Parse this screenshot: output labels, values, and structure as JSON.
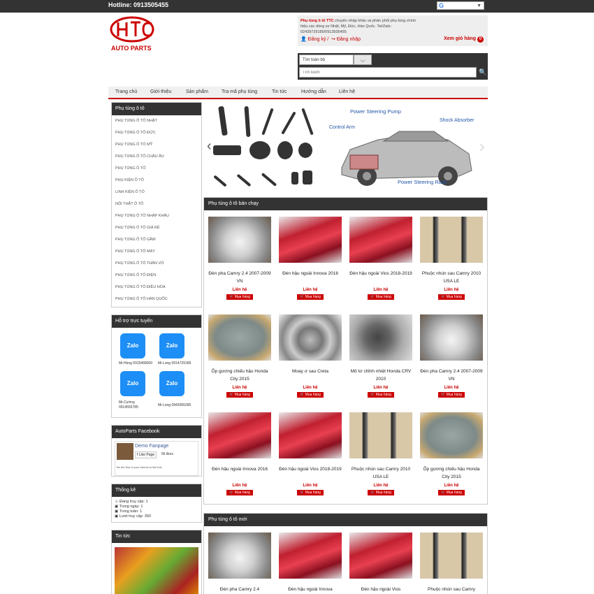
{
  "header": {
    "hotline": "Hotline: 0913505455",
    "translate_label": "G",
    "logo_text": "AUTO PARTS",
    "info_brand": "Phụ tùng ô tô TTC",
    "info_text": " chuyên nhập khẩu và phân phối phụ tùng chính hiệu các dòng xe Nhật, Mỹ, Đức, Hàn Quốc. Tel/Zalo: 02439729185/0913505455",
    "register": "Đăng ký",
    "login": "Đăng nhập",
    "cart": "Xem giỏ hàng",
    "cart_count": "0"
  },
  "search": {
    "category": "Tìm toàn bộ",
    "placeholder": "Tìm kiếm"
  },
  "nav": [
    "Trang chủ",
    "Giới thiệu",
    "Sản phẩm",
    "Tra mã phụ tùng",
    "Tin tức",
    "Hướng dẫn",
    "Liên hệ"
  ],
  "sidebar": {
    "cat_title": "Phụ tùng ô tô",
    "categories": [
      "PHỤ TÙNG Ô TÔ NHẬT",
      "PHỤ TÙNG Ô TÔ ĐỨC",
      "PHỤ TÙNG Ô TÔ MỸ",
      "PHỤ TÙNG Ô TÔ CHÂU ÂU",
      "PHỤ TÙNG Ô TÔ",
      "PHỤ KIỆN Ô TÔ",
      "LINH KIỆN Ô TÔ",
      "NỘI THẤT Ô TÔ",
      "PHỤ TÙNG Ô TÔ NHẬP KHẨU",
      "PHỤ TÙNG Ô TÔ GIÁ RẺ",
      "PHỤ TÙNG Ô TÔ GẦM",
      "PHỤ TÙNG Ô TÔ MÁY",
      "PHỤ TÙNG Ô TÔ THÂN VỎ",
      "PHỤ TÙNG Ô TÔ ĐIỆN",
      "PHỤ TÙNG Ô TÔ ĐIỀU HÒA",
      "PHỤ TÙNG Ô TÔ HÀN QUỐC"
    ],
    "support_title": "Hỗ trợ trực tuyến",
    "zalo": "Zalo",
    "supporters": [
      "Mr.Hùng 0915468000",
      "Mr.Long 0914729189",
      "Mr.Cường 0914555785",
      "Mr.Long 0943055285"
    ],
    "fb_title": "AutoParts Facebook",
    "fb_page": "Demo Fanpage",
    "fb_like": "Like Page",
    "fb_likes": "56 likes",
    "fb_friends": "Be the first of your friends to like this",
    "stats_title": "Thống kê",
    "stats": [
      "Đang truy cập: 1",
      "Trong ngày: 1",
      "Trong tuần: 1",
      "Lượt truy cập: 350"
    ],
    "news_title": "Tin tức"
  },
  "banner": {
    "labels": [
      "Power Steering Pump",
      "Control Arm",
      "Shock Absorber",
      "Power Steering Rack"
    ]
  },
  "sections": [
    {
      "title": "Phụ tùng ô tô bán chạy"
    },
    {
      "title": "Phụ tùng ô tô mới"
    }
  ],
  "products": {
    "price": "Liên hệ",
    "buy": "Mua hàng",
    "best": [
      "Đèn pha Camry 2.4 2007-2009 VN",
      "Đèn hậu ngoài Innova 2016",
      "Đèn hậu ngoài Vios 2018-2019",
      "Phuộc nhún sau Camry 2010 USA LE",
      "Ốp gương chiếu hậu Honda City 2015",
      "Moay ơ sau Creta",
      "Mô tơ chỉnh nhiệt Honda CRV 2010",
      "Đèn pha Camry 2.4 2007-2009 VN",
      "Đèn hậu ngoài Innova 2016",
      "Đèn hậu ngoài Vios 2018-2019",
      "Phuộc nhún sau Camry 2010 USA LE",
      "Ốp gương chiếu hậu Honda City 2015"
    ],
    "new": [
      "Đèn pha Camry 2.4",
      "Đèn hậu ngoài Innova",
      "Đèn hậu ngoài Vios",
      "Phuộc nhún sau Camry"
    ]
  },
  "colors": {
    "accent": "#cc0000",
    "dark": "#333333"
  }
}
